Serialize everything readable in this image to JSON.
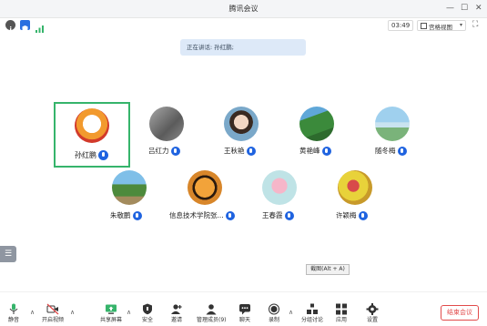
{
  "window": {
    "title": "腾讯会议"
  },
  "toolbar": {
    "timer": "03:49",
    "view_label": "宫格视图"
  },
  "banner": {
    "speaking": "正在讲话: 孙红鹏;"
  },
  "participants": [
    {
      "name": "孙红鹏"
    },
    {
      "name": "吕红力"
    },
    {
      "name": "王秋艳"
    },
    {
      "name": "黄艳峰"
    },
    {
      "name": "随冬梅"
    },
    {
      "name": "朱敬鹏"
    },
    {
      "name": "信息技术学院张..."
    },
    {
      "name": "王春霞"
    },
    {
      "name": "许颖梅"
    }
  ],
  "tooltip": {
    "text": "截图(Alt + A)"
  },
  "bottom_toolbar": {
    "mute": "静音",
    "video": "开启视频",
    "share": "共享屏幕",
    "security": "安全",
    "invite": "邀请",
    "members": "管理成员(9)",
    "chat": "聊天",
    "record": "录制",
    "breakout": "分组讨论",
    "apps": "应用",
    "settings": "设置",
    "end": "结束会议"
  },
  "colors": {
    "accent": "#1f63e0",
    "active_border": "#36b46b",
    "end": "#e24b4b"
  }
}
